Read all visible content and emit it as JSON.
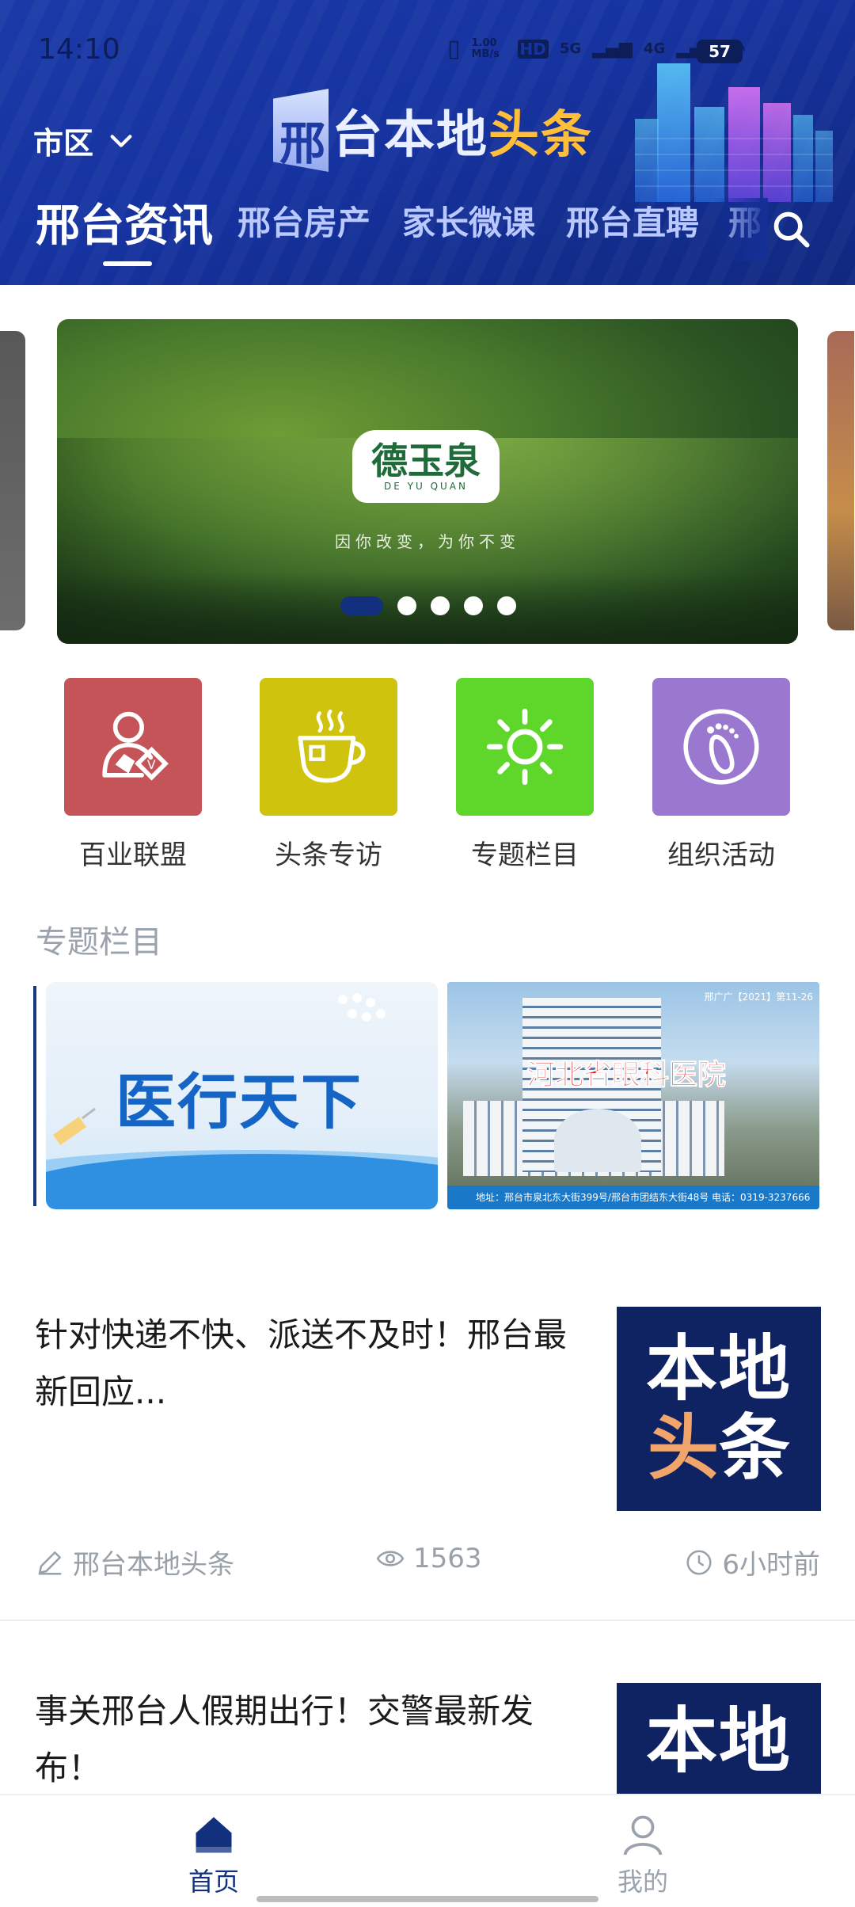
{
  "status_bar": {
    "time": "14:10",
    "net_speed": "1.00 MB/s",
    "hd": "HD",
    "signal1": "5G",
    "signal2": "4G",
    "battery": "57"
  },
  "header": {
    "city_selector": "市区",
    "logo_char_boxed": "邢",
    "logo_text_white": "台本地",
    "logo_text_orange": "头条"
  },
  "tabs": [
    {
      "label": "邢台资讯",
      "active": true
    },
    {
      "label": "邢台房产",
      "active": false
    },
    {
      "label": "家长微课",
      "active": false
    },
    {
      "label": "邢台直聘",
      "active": false
    },
    {
      "label": "邢",
      "active": false
    }
  ],
  "banner": {
    "brand_name": "德玉泉",
    "brand_en": "DE YU QUAN",
    "slogan": "因你改变，为你不变",
    "page_count": 5,
    "active_index": 0
  },
  "grid_nav": [
    {
      "label": "百业联盟",
      "icon": "alliance-icon",
      "color": "#c45457"
    },
    {
      "label": "头条专访",
      "icon": "coffee-cup-icon",
      "color": "#cfc30d"
    },
    {
      "label": "专题栏目",
      "icon": "sun-icon",
      "color": "#5fd62a"
    },
    {
      "label": "组织活动",
      "icon": "footprint-icon",
      "color": "#9b78d0"
    }
  ],
  "special_section": {
    "title": "专题栏目",
    "cards": [
      {
        "title": "医行天下"
      },
      {
        "title": "河北省眼科医院",
        "top_note": "邢广广【2021】第11-26",
        "address": "地址：邢台市泉北东大街399号/邢台市团结东大街48号  电话：0319-3237666"
      }
    ]
  },
  "news": [
    {
      "title": "针对快递不快、派送不及时！邢台最新回应...",
      "thumb_line1": "本地",
      "thumb_line2a": "头",
      "thumb_line2b": "条",
      "author": "邢台本地头条",
      "views": "1563",
      "time": "6小时前"
    },
    {
      "title": "事关邢台人假期出行！交警最新发布！",
      "thumb_line1": "本地"
    }
  ],
  "bottom_nav": [
    {
      "label": "首页",
      "icon": "home-icon",
      "active": true
    },
    {
      "label": "我的",
      "icon": "person-icon",
      "active": false
    }
  ],
  "colors": {
    "header_blue": "#1633a0",
    "active_nav": "#13307f",
    "inactive_nav": "#9aa3ad"
  }
}
